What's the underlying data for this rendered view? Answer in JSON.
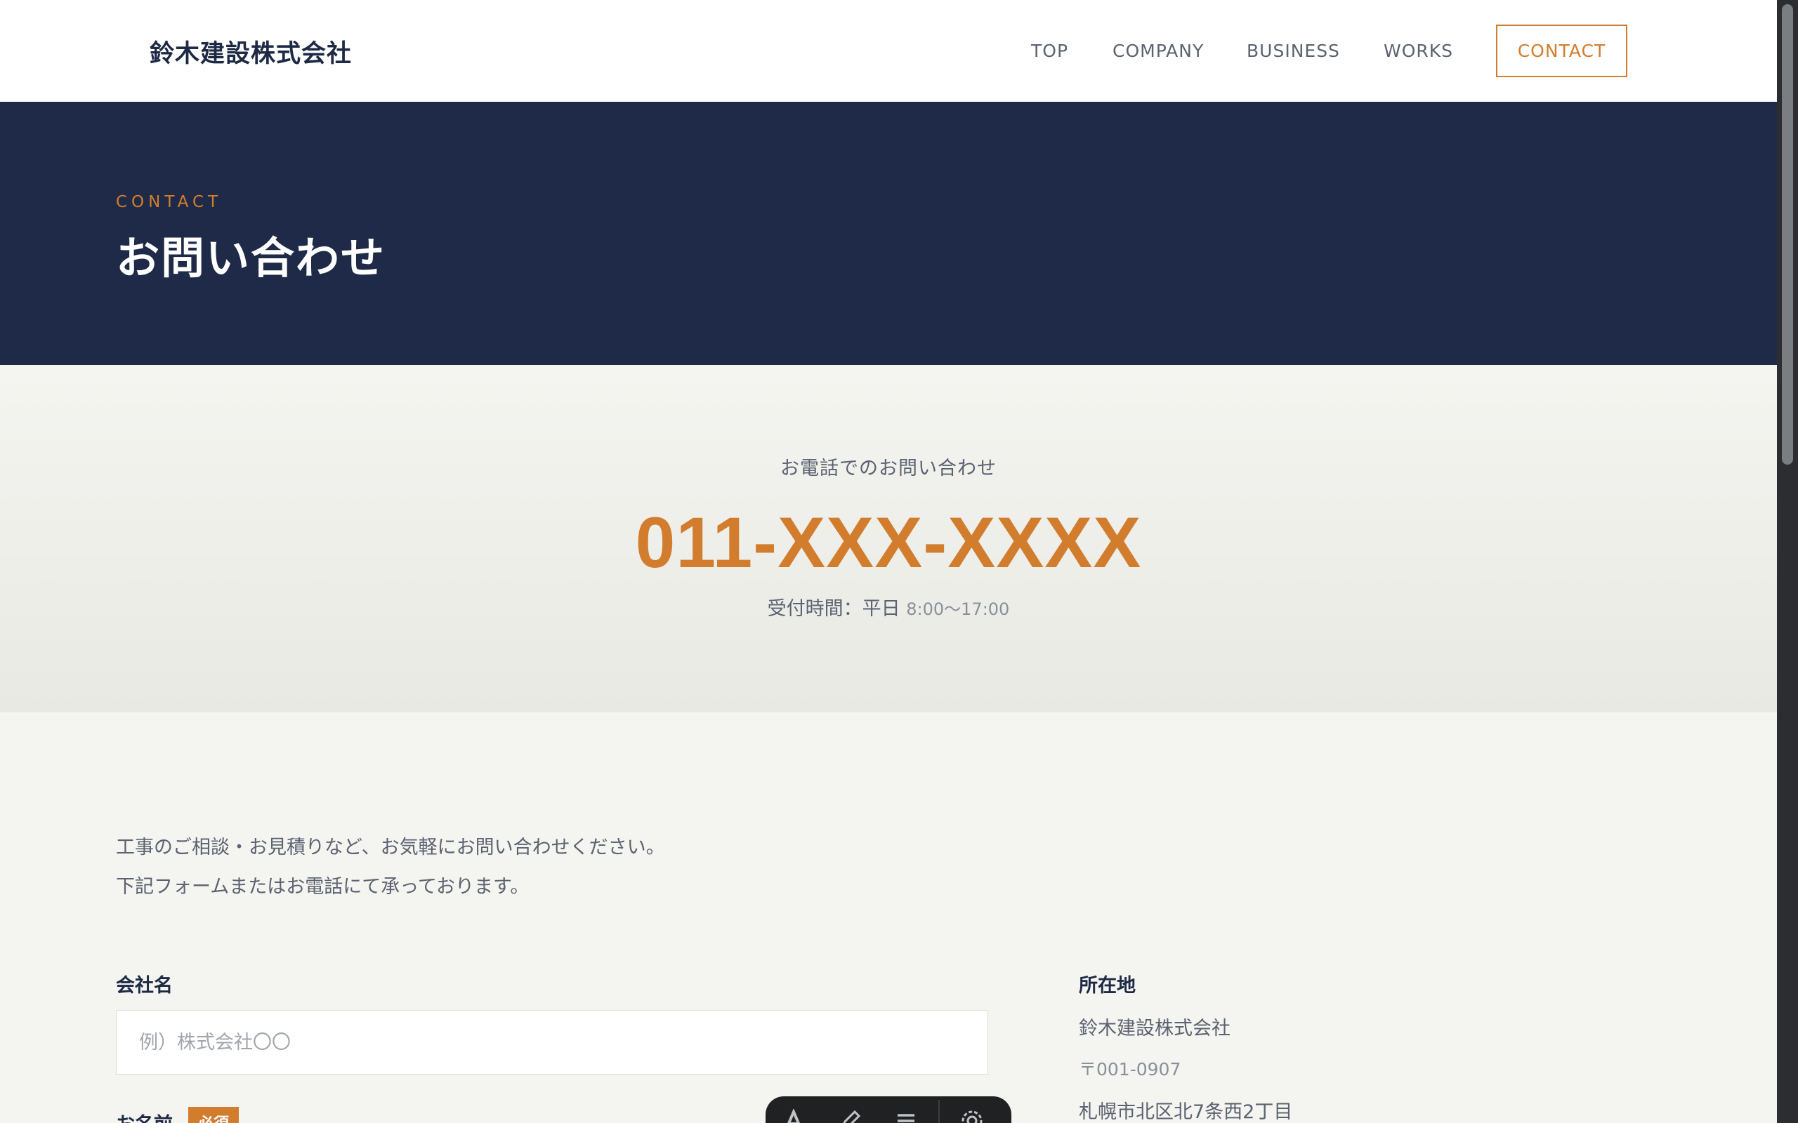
{
  "header": {
    "logo": "鈴木建設株式会社",
    "nav": [
      {
        "label": "TOP"
      },
      {
        "label": "COMPANY"
      },
      {
        "label": "BUSINESS"
      },
      {
        "label": "WORKS"
      }
    ],
    "contact_label": "CONTACT"
  },
  "hero": {
    "eyebrow": "CONTACT",
    "title": "お問い合わせ"
  },
  "phone": {
    "label": "お電話でのお問い合わせ",
    "number": "011-XXX-XXXX",
    "hours_prefix": "受付時間：平日",
    "hours_time": "8:00〜17:00"
  },
  "intro": {
    "line1": "工事のご相談・お見積りなど、お気軽にお問い合わせください。",
    "line2": "下記フォームまたはお電話にて承っております。"
  },
  "form": {
    "company": {
      "label": "会社名",
      "placeholder": "例）株式会社〇〇",
      "value": ""
    },
    "name": {
      "label": "お名前",
      "badge": "必須"
    }
  },
  "address": {
    "title": "所在地",
    "company": "鈴木建設株式会社",
    "postal": "〒001-0907",
    "street": "札幌市北区北7条西2丁目"
  },
  "toolbar": {
    "icons": [
      "text-icon",
      "pen-icon",
      "list-icon",
      "gear-icon"
    ]
  },
  "colors": {
    "accent": "#d27d2e",
    "navy": "#1e2a48",
    "background": "#f4f4f0"
  }
}
